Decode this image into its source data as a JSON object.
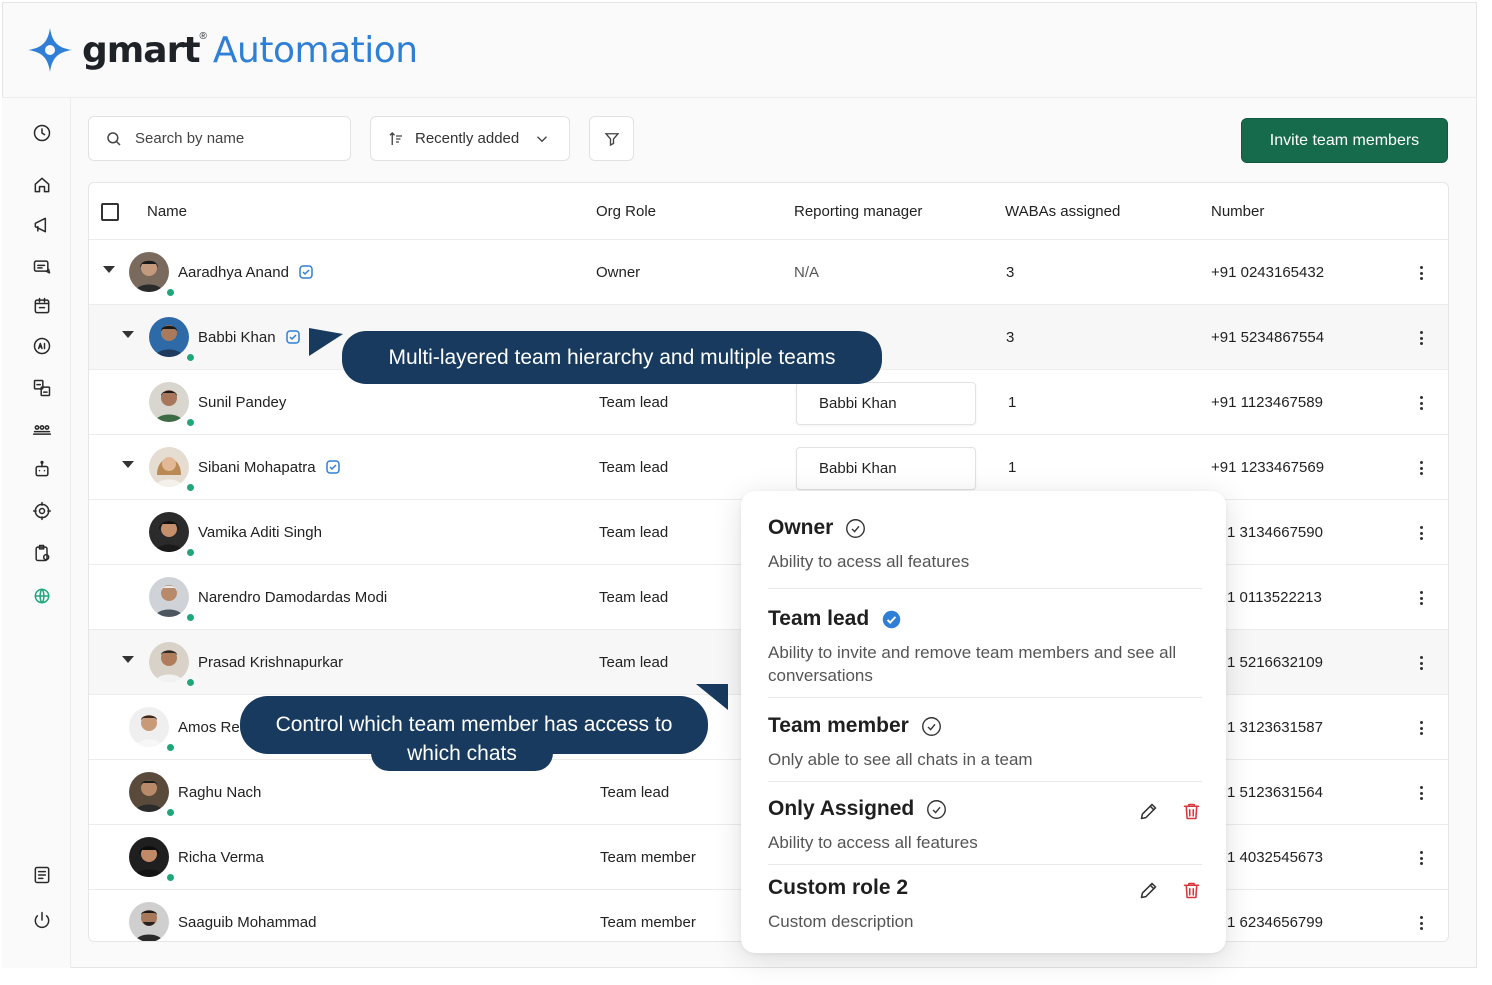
{
  "brand": {
    "name": "gmart",
    "registered": "®",
    "product": "Automation"
  },
  "toolbar": {
    "search_placeholder": "Search by name",
    "sort_label": "Recently added",
    "invite_label": "Invite team members"
  },
  "table": {
    "columns": [
      "Name",
      "Org Role",
      "Reporting manager",
      "WABAs assigned",
      "Number"
    ],
    "rows": [
      {
        "name": "Aaradhya Anand",
        "role": "Owner",
        "manager": "N/A",
        "wabas": "3",
        "number": "+91 0243165432"
      },
      {
        "name": "Babbi Khan",
        "role": "",
        "manager": "",
        "wabas": "3",
        "number": "+91 5234867554"
      },
      {
        "name": "Sunil Pandey",
        "role": "Team lead",
        "manager": "Babbi Khan",
        "wabas": "1",
        "number": "+91 1123467589"
      },
      {
        "name": "Sibani Mohapatra",
        "role": "Team lead",
        "manager": "Babbi Khan",
        "wabas": "1",
        "number": "+91 1233467569"
      },
      {
        "name": "Vamika Aditi Singh",
        "role": "Team lead",
        "manager": "",
        "wabas": "",
        "number": "1 3134667590"
      },
      {
        "name": "Narendro Damodardas Modi",
        "role": "Team lead",
        "manager": "",
        "wabas": "",
        "number": "1 0113522213"
      },
      {
        "name": "Prasad Krishnapurkar",
        "role": "Team lead",
        "manager": "",
        "wabas": "",
        "number": "1 5216632109"
      },
      {
        "name": "Amos Rea",
        "role": "",
        "manager": "",
        "wabas": "",
        "number": "1 3123631587"
      },
      {
        "name": "Raghu Nach",
        "role": "Team lead",
        "manager": "",
        "wabas": "",
        "number": "1 5123631564"
      },
      {
        "name": "Richa Verma",
        "role": "Team member",
        "manager": "",
        "wabas": "",
        "number": "1 4032545673"
      },
      {
        "name": "Saaguib Mohammad",
        "role": "Team member",
        "manager": "",
        "wabas": "",
        "number": "1 6234656799"
      }
    ]
  },
  "callouts": {
    "hierarchy": "Multi-layered team hierarchy and multiple teams",
    "access_line1": "Control which team member has access to",
    "access_line2": "which chats"
  },
  "roles": [
    {
      "title": "Owner",
      "description": "Ability to acess all features",
      "selected": false,
      "editable": false
    },
    {
      "title": "Team lead",
      "description": "Ability to invite and remove team members and see all conversations",
      "selected": true,
      "editable": false
    },
    {
      "title": "Team member",
      "description": "Only able to see all chats in a team",
      "selected": false,
      "editable": false
    },
    {
      "title": "Only Assigned",
      "description": "Ability to access all features",
      "selected": false,
      "editable": true
    },
    {
      "title": "Custom role 2",
      "description": "Custom description",
      "selected": false,
      "editable": true
    }
  ],
  "sidebar_icons": [
    "clock-icon",
    "home-icon",
    "megaphone-icon",
    "message-edit-icon",
    "calendar-icon",
    "ai-icon",
    "translate-icon",
    "team-icon",
    "bot-icon",
    "settings-icon",
    "clipboard-icon",
    "globe-icon",
    "document-icon",
    "power-icon"
  ],
  "colors": {
    "accent_green": "#176b4d",
    "callout_navy": "#173a5e",
    "brand_blue": "#2f7fd6",
    "online_dot": "#21a67a",
    "delete_red": "#d9363e",
    "verified_blue": "#2f7fd6"
  }
}
